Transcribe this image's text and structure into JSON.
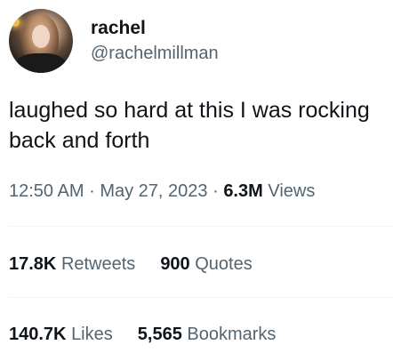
{
  "tweet": {
    "author": {
      "display_name": "rachel",
      "handle": "@rachelmillman",
      "avatar_icon": "profile-photo"
    },
    "text_line1": "laughed so hard at this I was rocking",
    "text_line2": "back and forth",
    "time": "12:50 AM",
    "separator": "·",
    "date": "May 27, 2023",
    "views_count": "6.3M",
    "views_label": "Views"
  },
  "stats": {
    "retweets": {
      "count": "17.8K",
      "label": "Retweets"
    },
    "quotes": {
      "count": "900",
      "label": "Quotes"
    },
    "likes": {
      "count": "140.7K",
      "label": "Likes"
    },
    "bookmarks": {
      "count": "5,565",
      "label": "Bookmarks"
    }
  },
  "colors": {
    "text_primary": "#0f1419",
    "text_secondary": "#536471",
    "divider": "#eff3f4"
  }
}
